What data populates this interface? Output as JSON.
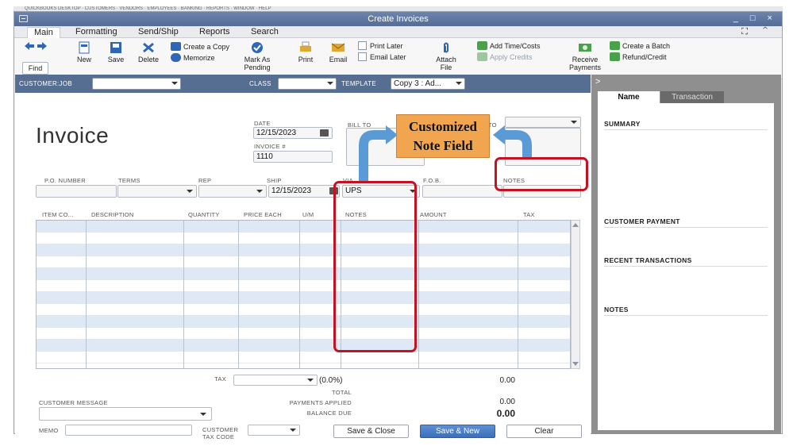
{
  "window": {
    "title": "Create Invoices"
  },
  "top_strip": "QUICKBOOKS DESKTOP  ·  CUSTOMERS  ·  VENDORS  ·  EMPLOYEES  ·  BANKING  ·  REPORTS  ·  WINDOW  ·  HELP",
  "tabs": [
    {
      "label": "Main",
      "active": true
    },
    {
      "label": "Formatting"
    },
    {
      "label": "Send/Ship"
    },
    {
      "label": "Reports"
    },
    {
      "label": "Search"
    }
  ],
  "toolbar": {
    "find": "Find",
    "new": "New",
    "save": "Save",
    "delete": "Delete",
    "create_copy": "Create a Copy",
    "memorize": "Memorize",
    "mark_as": "Mark As",
    "pending": "Pending",
    "print": "Print",
    "email": "Email",
    "print_later": "Print Later",
    "email_later": "Email Later",
    "attach": "Attach",
    "file": "File",
    "add_time_costs": "Add Time/Costs",
    "apply_credits": "Apply Credits",
    "receive": "Receive",
    "payments": "Payments",
    "create_batch": "Create a Batch",
    "refund_credit": "Refund/Credit"
  },
  "customer_bar": {
    "customer_job_label": "CUSTOMER:JOB",
    "customer_job_value": "",
    "class_label": "CLASS",
    "class_value": "",
    "template_label": "TEMPLATE",
    "template_value": "Copy 3 : Ad..."
  },
  "invoice": {
    "title": "Invoice",
    "date_label": "DATE",
    "date_value": "12/15/2023",
    "invoice_no_label": "INVOICE #",
    "invoice_no_value": "1110",
    "bill_to_label": "BILL TO",
    "ship_to_label": "SHIP TO",
    "po_number_label": "P.O. NUMBER",
    "terms_label": "TERMS",
    "rep_label": "REP",
    "ship_label": "SHIP",
    "ship_value": "12/15/2023",
    "via_label": "VIA",
    "via_value": "UPS",
    "fob_label": "F.O.B.",
    "notes_label": "NOTES"
  },
  "line_items": {
    "columns": [
      "ITEM CO...",
      "DESCRIPTION",
      "QUANTITY",
      "PRICE EACH",
      "U/M",
      "NOTES",
      "AMOUNT",
      "TAX"
    ],
    "row_count": 12
  },
  "totals": {
    "tax_label": "TAX",
    "tax_rate": "(0.0%)",
    "tax_amount": "0.00",
    "total_label": "TOTAL",
    "payments_applied_label": "PAYMENTS APPLIED",
    "payments_applied_value": "0.00",
    "balance_due_label": "BALANCE DUE",
    "balance_due_value": "0.00"
  },
  "footer": {
    "customer_message_label": "CUSTOMER MESSAGE",
    "memo_label": "MEMO",
    "customer_tax_code_label_1": "CUSTOMER",
    "customer_tax_code_label_2": "TAX CODE",
    "save_close": "Save & Close",
    "save_new": "Save & New",
    "clear": "Clear"
  },
  "right_panel": {
    "tab_name": "Name",
    "tab_transaction": "Transaction",
    "summary": "SUMMARY",
    "customer_payment": "CUSTOMER PAYMENT",
    "recent_transactions": "RECENT TRANSACTIONS",
    "notes": "NOTES"
  },
  "annotation": {
    "callout_line_1": "Customized",
    "callout_line_2": "Note Field",
    "callout_color": "#f1a54f",
    "arrow_color": "#5b9bd5",
    "highlight_color": "#c41222"
  }
}
